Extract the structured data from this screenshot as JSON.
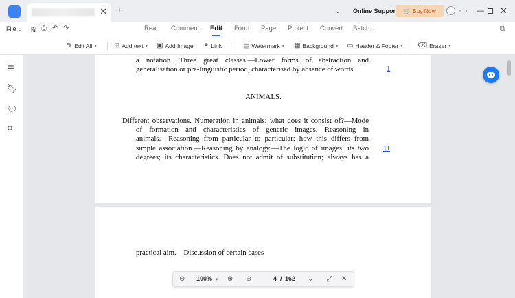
{
  "titlebar": {
    "tab_close": "✕",
    "new_tab": "+",
    "dropdown": "⌄",
    "online_support": "Online Support",
    "buy_now": "Buy Now",
    "more": "···",
    "minimize": "—",
    "close": "✕"
  },
  "menubar": {
    "file": "File",
    "tabs": [
      "Read",
      "Comment",
      "Edit",
      "Form",
      "Page",
      "Protect",
      "Convert",
      "Batch"
    ],
    "active_tab": "Edit"
  },
  "toolbar": {
    "edit_all": "Edit All",
    "add_text": "Add text",
    "add_image": "Add Image",
    "link": "Link",
    "watermark": "Watermark",
    "background": "Background",
    "header_footer": "Header & Footer",
    "eraser": "Eraser"
  },
  "document": {
    "para1": [
      "a notation. Three great classes.—Lower forms of abstraction and",
      "generalisation or pre-linguistic period, characterised by absence of words"
    ],
    "ref1": "1",
    "heading": "ANIMALS.",
    "para2": [
      "Different observations. Numeration in animals; what does it consist of?—Mode",
      "of formation and characteristics of generic images. Reasoning in",
      "animals.—Reasoning from particular to particular: how this differs from",
      "simple association.—Reasoning by analogy.—The logic of images: its two",
      "degrees; its characteristics. Does not admit of substitution; always has a"
    ],
    "ref2": "11",
    "page2_line": "practical aim.—Discussion of certain cases"
  },
  "zoombar": {
    "zoom": "100%",
    "page_current": "4",
    "page_total": "162",
    "page_sep": "/"
  },
  "colors": {
    "accent": "#2563eb",
    "buy_now_bg": "#f7d7b3",
    "buy_now_text": "#d9541f",
    "canvas": "#e6e7ea"
  }
}
